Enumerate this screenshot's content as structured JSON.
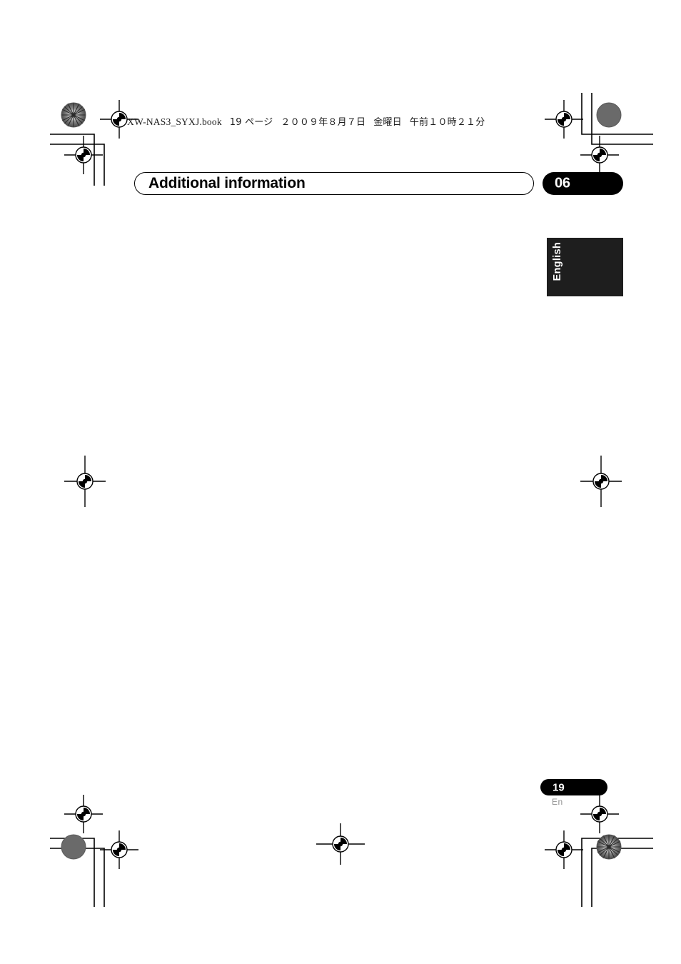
{
  "document": {
    "print_header": {
      "filename": "XW-NAS3_SYXJ.book",
      "page_label": "19 ページ",
      "date": "２００９年８月７日",
      "weekday": "金曜日",
      "time": "午前１０時２１分"
    },
    "chapter": {
      "title": "Additional information",
      "number": "06"
    },
    "language_tab": {
      "label": "English"
    },
    "footer": {
      "page_number": "19",
      "language_code": "En"
    },
    "colors": {
      "badge_background": "#000000",
      "badge_text": "#ffffff",
      "tab_background": "#1e1e1e",
      "title_outline": "#000000",
      "title_shadow": "#b8b8b8",
      "footer_code_text": "#909090",
      "page_background": "#ffffff"
    },
    "print_marks": {
      "registration_target": "registration-target-icon",
      "starburst": "starburst-test-patch-icon",
      "gray_dot": "gray-density-patch-icon",
      "crop_corner": "crop-mark-icon"
    }
  }
}
